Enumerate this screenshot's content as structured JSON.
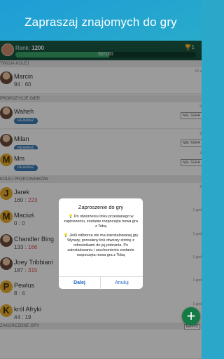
{
  "headline": "Zapraszaj znajomych do gry",
  "rankbar": {
    "label": "Rank:",
    "value": "1200",
    "trophy_icon": "trophy-icon",
    "trophy_value": "1",
    "progress_text": "52/100",
    "progress_fraction": 0.52
  },
  "sections": {
    "my_turn": "TWOJA KOLEJ",
    "proposals": "PROPOZYCJE GIER",
    "opponent_turn": "KOLEJ PRZECIWNIKÓW",
    "finished": "ZAKOŃCZONE GRY"
  },
  "my_turn": [
    {
      "name": "Marcin",
      "score_a": "94",
      "score_b": "60",
      "sep": " : ",
      "time": "52 s"
    }
  ],
  "proposals": [
    {
      "name": "Waheh",
      "badge": "REWANŻ",
      "time": "9",
      "action": "NIE TERA"
    },
    {
      "name": "Milan",
      "badge": "REWANŻ",
      "time": "9",
      "action": "NIE TERA"
    },
    {
      "name": "Mm",
      "badge": "REWANŻ",
      "time": "4",
      "action": "NIE TERA"
    }
  ],
  "opponent_turn": [
    {
      "name": "Jarek",
      "letter": "J",
      "score_a": "160",
      "score_b": "223",
      "sep": " : ",
      "time": "2"
    },
    {
      "name": "Maciuś",
      "letter": "M",
      "score_a": "0",
      "score_b": "0",
      "sep": " : ",
      "time": "1 god"
    },
    {
      "name": "Chandler Bing",
      "letter": "",
      "score_a": "133",
      "score_b": "166",
      "sep": " : ",
      "time": "1 god"
    },
    {
      "name": "Joey Tribbiani",
      "letter": "",
      "score_a": "187",
      "score_b": "315",
      "sep": " : ",
      "time": "1 god"
    },
    {
      "name": "Pewlus",
      "letter": "P",
      "score_a": "8",
      "score_b": "4",
      "sep": " : ",
      "time": "1 god"
    },
    {
      "name": "król Afryki",
      "letter": "K",
      "score_a": "44",
      "score_b": "19",
      "sep": " : ",
      "time": "1 god"
    }
  ],
  "dialog": {
    "title": "Zaproszenie do gry",
    "bulb_icon": "lightbulb-icon",
    "text1": "Po otworzeniu linku przesłanego w zaproszeniu, zostanie rozpoczęta nowa gra z Tobą",
    "text2": "Jeśli odbiorca nie ma zainstalowanej gry Wyrazy, przesłany link otworzy stronę z odnośnikami do jej pobrania. Po zainstalowaniu i uruchomieniu zostanie rozpoczęta nowa gra z Tobą",
    "ok": "Dalej",
    "cancel": "Anuluj"
  },
  "fab_icon": "plus-icon",
  "edit_label": "EDYTU"
}
